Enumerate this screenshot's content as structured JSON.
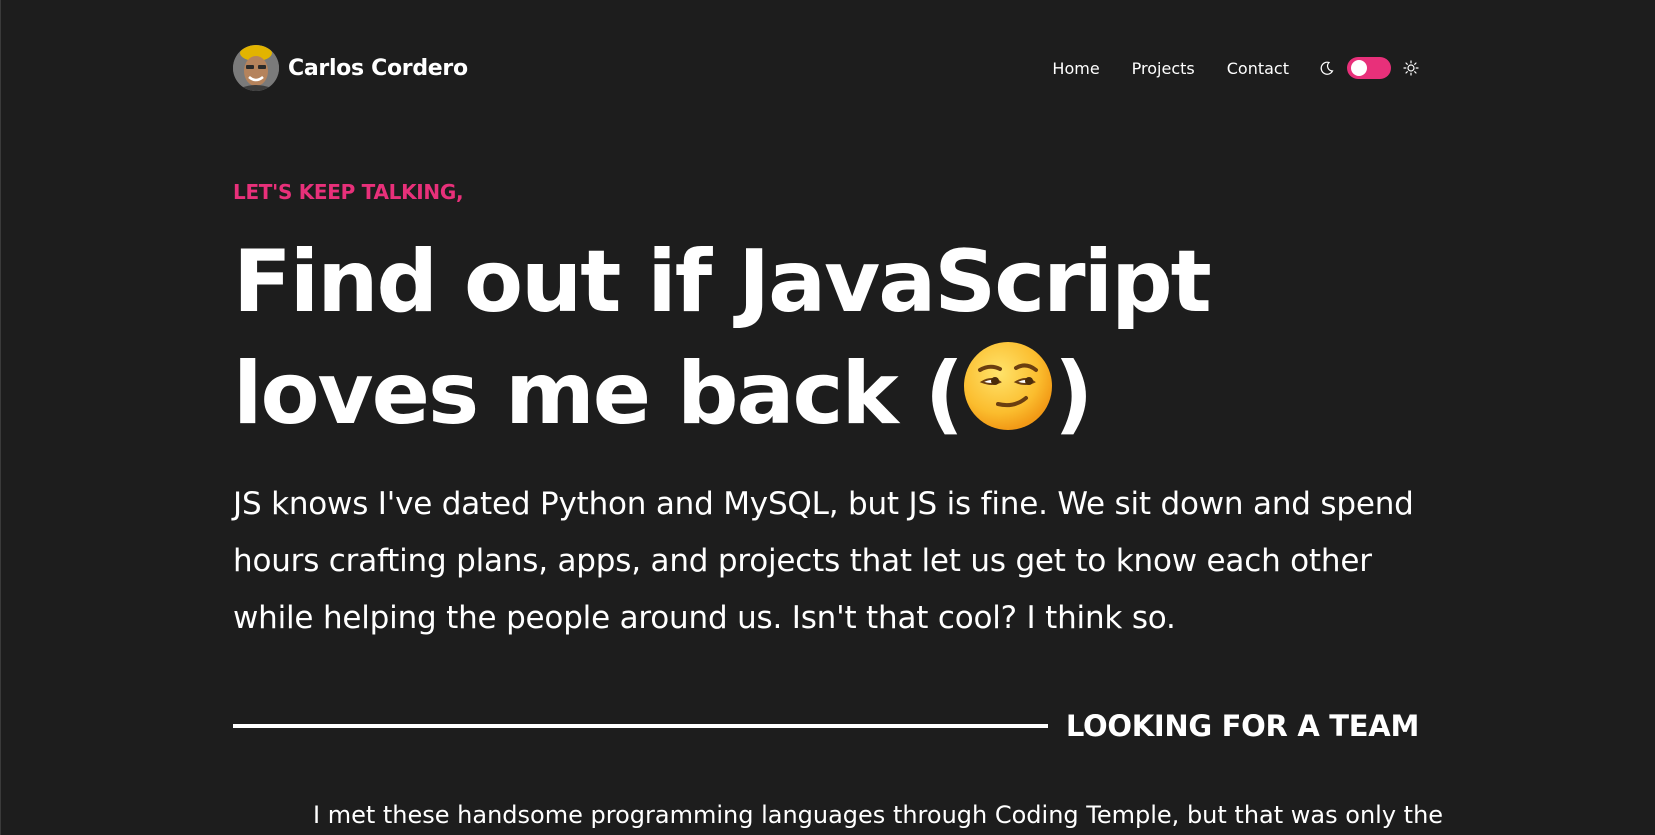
{
  "header": {
    "brand_name": "Carlos Cordero",
    "nav": [
      {
        "label": "Home"
      },
      {
        "label": "Projects"
      },
      {
        "label": "Contact"
      }
    ],
    "theme_toggle": {
      "left_icon": "moon-icon",
      "right_icon": "sun-icon",
      "state": "on"
    }
  },
  "hero": {
    "eyebrow": "LET'S KEEP TALKING,",
    "headline_line1": "Find out if JavaScript",
    "headline_line2": "loves me back",
    "headline_open_paren": "(",
    "headline_close_paren": ")",
    "headline_emoji": "smirking-face-emoji",
    "intro": "JS knows I've dated Python and MySQL, but JS is fine. We sit down and spend hours crafting plans, apps, and projects that let us get to know each other while helping the people around us. Isn't that cool? I think so."
  },
  "section": {
    "title": "LOOKING FOR A TEAM",
    "body": "I met these handsome programming languages through Coding Temple, but that was only the"
  },
  "colors": {
    "background": "#1d1d1d",
    "accent": "#e8307a",
    "text": "#ffffff"
  }
}
